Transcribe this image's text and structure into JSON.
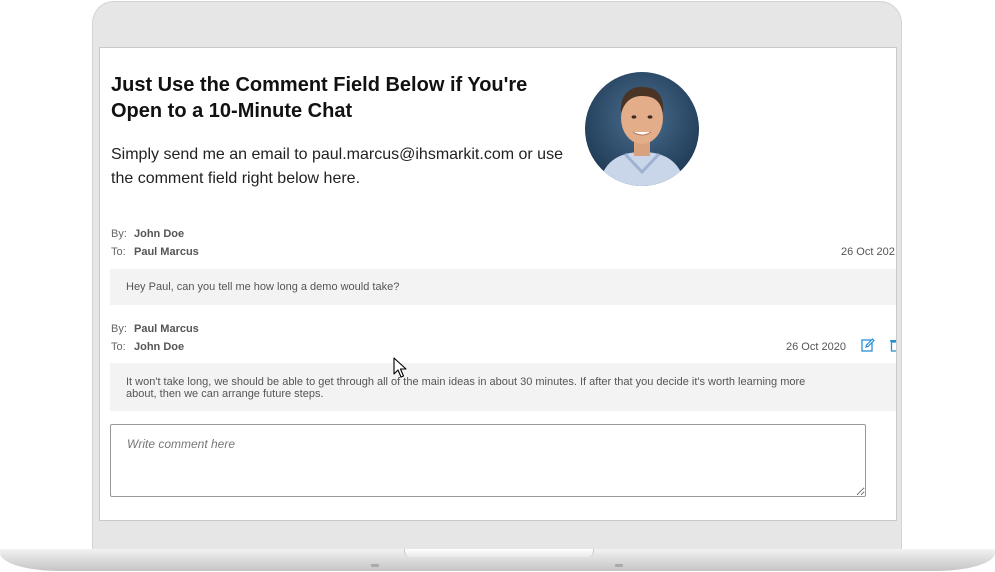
{
  "hero": {
    "title": "Just Use the Comment Field Below if You're Open to a 10-Minute Chat",
    "subtitle": "Simply send me an email to paul.marcus@ihsmarkit.com or use the comment field right below here."
  },
  "meta_labels": {
    "by": "By:",
    "to": "To:"
  },
  "comments": [
    {
      "by": "John Doe",
      "to": "Paul Marcus",
      "date": "26 Oct 202",
      "text": "Hey Paul, can you tell me how long a demo would take?"
    },
    {
      "by": "Paul Marcus",
      "to": "John Doe",
      "date": "26 Oct 2020",
      "text": "It won't take long, we should be able to get through all of the main ideas in about 30 minutes. If after that you decide it's worth learning more about, then we can arrange future steps."
    }
  ],
  "comment_input": {
    "placeholder": "Write comment here",
    "value": ""
  },
  "icons": {
    "edit": "edit-icon",
    "delete": "trash-icon",
    "accent": "#2a8fd6"
  }
}
